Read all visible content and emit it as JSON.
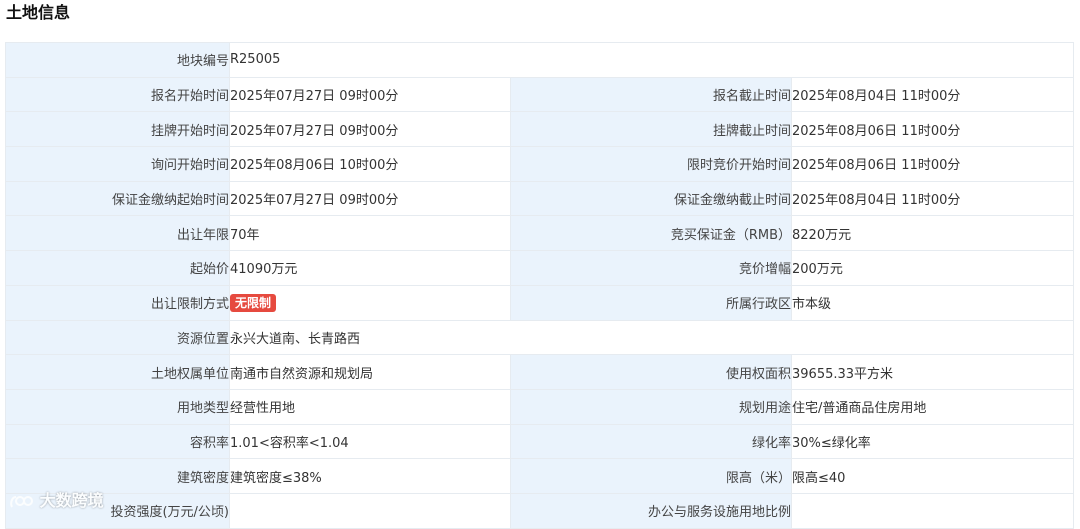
{
  "section_title": "土地信息",
  "rows": [
    {
      "label1": "地块编号",
      "value1": "R25005",
      "full": true
    },
    {
      "label1": "报名开始时间",
      "value1": "2025年07月27日 09时00分",
      "label2": "报名截止时间",
      "value2": "2025年08月04日 11时00分"
    },
    {
      "label1": "挂牌开始时间",
      "value1": "2025年07月27日 09时00分",
      "label2": "挂牌截止时间",
      "value2": "2025年08月06日 11时00分"
    },
    {
      "label1": "询问开始时间",
      "value1": "2025年08月06日 10时00分",
      "label2": "限时竞价开始时间",
      "value2": "2025年08月06日 11时00分"
    },
    {
      "label1": "保证金缴纳起始时间",
      "value1": "2025年07月27日 09时00分",
      "label2": "保证金缴纳截止时间",
      "value2": "2025年08月04日 11时00分"
    },
    {
      "label1": "出让年限",
      "value1": "70年",
      "label2": "竞买保证金（RMB）",
      "value2": "8220万元"
    },
    {
      "label1": "起始价",
      "value1": "41090万元",
      "label2": "竞价增幅",
      "value2": "200万元"
    },
    {
      "label1": "出让限制方式",
      "value1": "无限制",
      "tag": true,
      "label2": "所属行政区",
      "value2": "市本级"
    },
    {
      "label1": "资源位置",
      "value1": "永兴大道南、长青路西",
      "full": true
    },
    {
      "label1": "土地权属单位",
      "value1": "南通市自然资源和规划局",
      "label2": "使用权面积",
      "value2": "39655.33平方米"
    },
    {
      "label1": "用地类型",
      "value1": "经营性用地",
      "label2": "规划用途",
      "value2": "住宅/普通商品住房用地"
    },
    {
      "label1": "容积率",
      "value1": "1.01<容积率<1.04",
      "label2": "绿化率",
      "value2": "30%≤绿化率"
    },
    {
      "label1": "建筑密度",
      "value1": "建筑密度≤38%",
      "label2": "限高（米）",
      "value2": "限高≤40"
    },
    {
      "label1": "投资强度(万元/公顷)",
      "value1": "",
      "label2": "办公与服务设施用地比例",
      "value2": ""
    }
  ],
  "watermark": "大数跨境"
}
